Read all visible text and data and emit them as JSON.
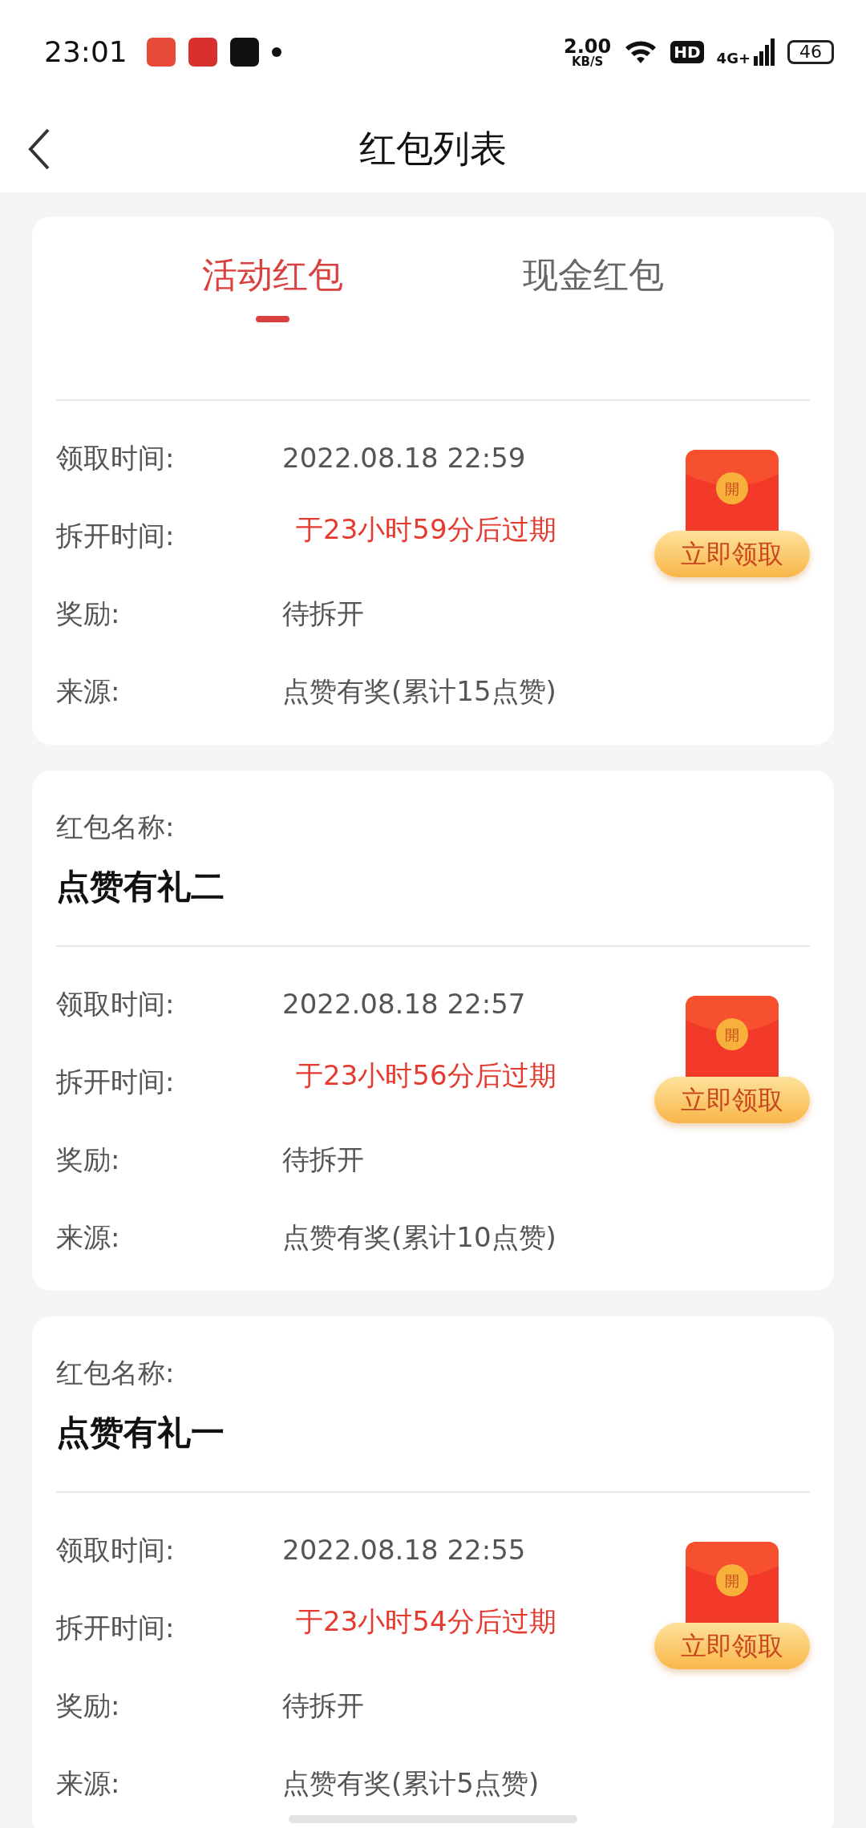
{
  "status_bar": {
    "time": "23:01",
    "speed": "2.00",
    "speed_unit": "KB/S",
    "hd": "HD",
    "network": "4G+",
    "battery": "46"
  },
  "nav": {
    "title": "红包列表"
  },
  "tabs": [
    {
      "label": "活动红包",
      "selected": true
    },
    {
      "label": "现金红包",
      "selected": false
    }
  ],
  "cards": [
    {
      "rows": [
        {
          "label": "领取时间:",
          "value": "2022.08.18 22:59",
          "kind": "plain"
        },
        {
          "label": "拆开时间:",
          "value": "于23小时59分后过期",
          "kind": "alert"
        },
        {
          "label": "奖励:",
          "value": "待拆开",
          "kind": "plain"
        },
        {
          "label": "来源:",
          "value": "点赞有奖(累计15点赞)",
          "kind": "plain"
        }
      ],
      "envelope": {
        "seal": "開",
        "button": "立即领取"
      }
    },
    {
      "title_label": "红包名称:",
      "title": "点赞有礼二",
      "rows": [
        {
          "label": "领取时间:",
          "value": "2022.08.18 22:57",
          "kind": "plain"
        },
        {
          "label": "拆开时间:",
          "value": "于23小时56分后过期",
          "kind": "alert"
        },
        {
          "label": "奖励:",
          "value": "待拆开",
          "kind": "plain"
        },
        {
          "label": "来源:",
          "value": "点赞有奖(累计10点赞)",
          "kind": "plain"
        }
      ],
      "envelope": {
        "seal": "開",
        "button": "立即领取"
      }
    },
    {
      "title_label": "红包名称:",
      "title": "点赞有礼一",
      "rows": [
        {
          "label": "领取时间:",
          "value": "2022.08.18 22:55",
          "kind": "plain"
        },
        {
          "label": "拆开时间:",
          "value": "于23小时54分后过期",
          "kind": "alert"
        },
        {
          "label": "奖励:",
          "value": "待拆开",
          "kind": "plain"
        },
        {
          "label": "来源:",
          "value": "点赞有奖(累计5点赞)",
          "kind": "plain"
        }
      ],
      "envelope": {
        "seal": "開",
        "button": "立即领取"
      }
    }
  ]
}
